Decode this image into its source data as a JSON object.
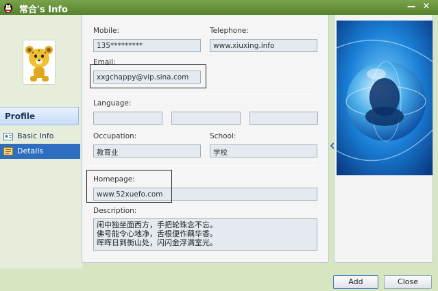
{
  "window": {
    "title": "常合's Info"
  },
  "titlebar": {
    "min_glyph": "—",
    "close_glyph": "✕"
  },
  "sidebar": {
    "header": "Profile",
    "items": [
      {
        "label": "Basic Info",
        "icon": "id-card-icon"
      },
      {
        "label": "Details",
        "icon": "details-icon",
        "selected": true
      }
    ]
  },
  "form": {
    "mobile": {
      "label": "Mobile:",
      "value": "135*********"
    },
    "telephone": {
      "label": "Telephone:",
      "value": "www.xiuxing.info"
    },
    "email": {
      "label": "Email:",
      "value": "xxgchappy@vip.sina.com"
    },
    "language": {
      "label": "Language:",
      "values": [
        "",
        "",
        ""
      ]
    },
    "occupation": {
      "label": "Occupation:",
      "value": "教育业"
    },
    "school": {
      "label": "School:",
      "value": "学校"
    },
    "homepage": {
      "label": "Homepage:",
      "value": "www.52xuefo.com"
    },
    "description": {
      "label": "Description:",
      "lines": [
        "闲中独坐面西方，手把轮珠念不忘。",
        "佛号能令心地净，舌根便作藕华香。",
        "晖晖日到衡山处，闪闪金浮满室光。"
      ]
    }
  },
  "buttons": {
    "add": "Add",
    "close": "Close"
  },
  "colors": {
    "titlebar": "#5f8c33",
    "selected_nav": "#2d6ec0",
    "accent_blue": "#1d6fcf"
  }
}
